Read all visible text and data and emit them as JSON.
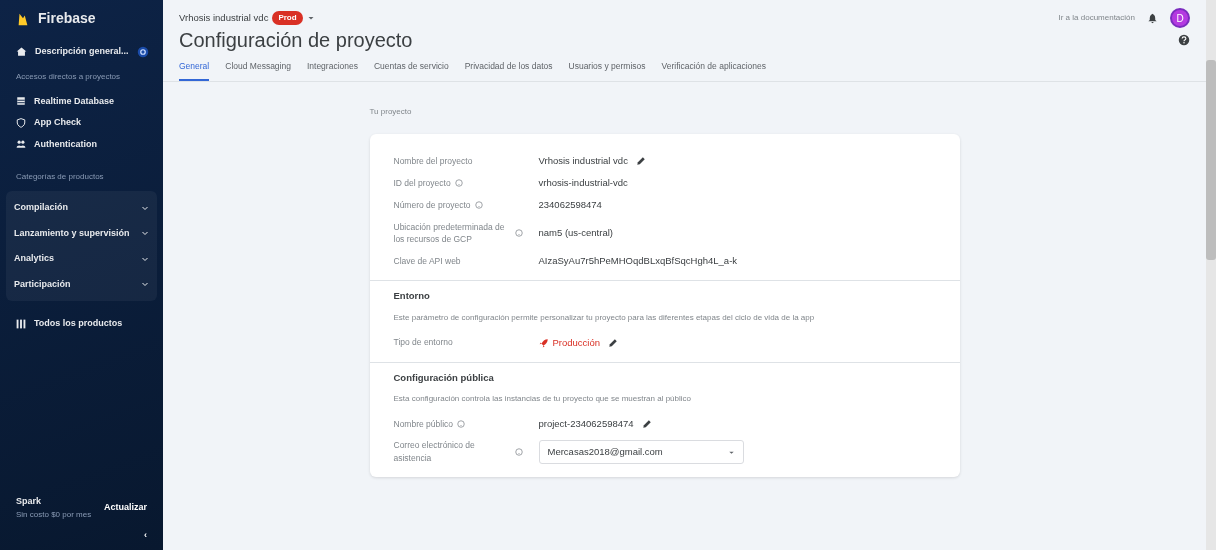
{
  "sidebar": {
    "brand": "Firebase",
    "overview": "Descripción general...",
    "shortcuts_heading": "Accesos directos a proyectos",
    "shortcuts": [
      {
        "label": "Realtime Database",
        "kind": "database"
      },
      {
        "label": "App Check",
        "kind": "shield"
      },
      {
        "label": "Authentication",
        "kind": "users"
      }
    ],
    "categories_heading": "Categorías de productos",
    "categories": [
      {
        "label": "Compilación"
      },
      {
        "label": "Lanzamiento y supervisión"
      },
      {
        "label": "Analytics"
      },
      {
        "label": "Participación"
      }
    ],
    "all_products": "Todos los productos",
    "plan": {
      "name": "Spark",
      "price": "Sin costo $0 por mes",
      "action": "Actualizar"
    },
    "collapse": "‹"
  },
  "topbar": {
    "project": "Vrhosis industrial vdc",
    "badge": "Prod",
    "docs": "Ir a la documentación",
    "avatar": "D"
  },
  "page": {
    "title": "Configuración de proyecto",
    "tabs": [
      {
        "label": "General",
        "selected": true
      },
      {
        "label": "Cloud Messaging",
        "selected": false
      },
      {
        "label": "Integraciones",
        "selected": false
      },
      {
        "label": "Cuentas de servicio",
        "selected": false
      },
      {
        "label": "Privacidad de los datos",
        "selected": false
      },
      {
        "label": "Usuarios y permisos",
        "selected": false
      },
      {
        "label": "Verificación de aplicaciones",
        "selected": false
      }
    ]
  },
  "section_title": "Tu proyecto",
  "sections": [
    {
      "rows": [
        {
          "label": "Nombre del proyecto",
          "value": "Vrhosis industrial vdc",
          "help": false,
          "editable": true
        },
        {
          "label": "ID del proyecto",
          "value": "vrhosis-industrial-vdc",
          "help": true,
          "editable": false
        },
        {
          "label": "Número de proyecto",
          "value": "234062598474",
          "help": true,
          "editable": false
        },
        {
          "label": "Ubicación predeterminada de los recursos de GCP",
          "value": "nam5 (us-central)",
          "help": true,
          "editable": false
        },
        {
          "label": "Clave de API web",
          "value": "AIzaSyAu7r5hPeMHOqdBLxqBfSqcHgh4L_a-k",
          "help": false,
          "editable": false
        }
      ]
    },
    {
      "title": "Entorno",
      "description": "Este parámetro de configuración permite personalizar tu proyecto para las diferentes etapas del ciclo de vida de la app",
      "rows": [
        {
          "label": "Tipo de entorno",
          "value": "Producción",
          "kind": "environment",
          "help": false,
          "editable": true
        }
      ]
    },
    {
      "title": "Configuración pública",
      "description": "Esta configuración controla las instancias de tu proyecto que se muestran al público",
      "rows": [
        {
          "label": "Nombre público",
          "value": "project-234062598474",
          "help": true,
          "editable": true
        },
        {
          "label": "Correo electrónico de asistencia",
          "value": "Mercasas2018@gmail.com",
          "kind": "select",
          "help": true,
          "editable": false
        }
      ]
    }
  ]
}
